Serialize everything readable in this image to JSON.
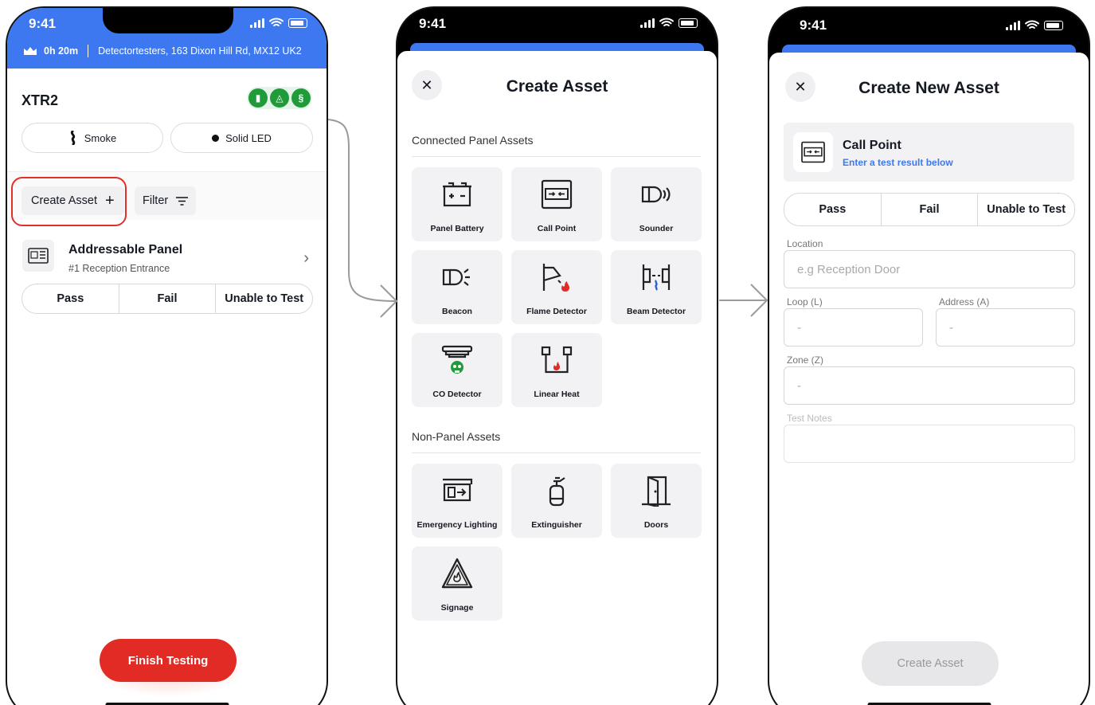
{
  "status_bar": {
    "time": "9:41"
  },
  "screen1": {
    "duration": "0h 20m",
    "site_address": "Detectortesters, 163 Dixon Hill Rd, MX12 UK2",
    "device_title": "XTR2",
    "pill_smoke": "Smoke",
    "pill_led": "Solid LED",
    "create_asset_label": "Create Asset",
    "filter_label": "Filter",
    "asset": {
      "name": "Addressable Panel",
      "subtitle": "#1 Reception Entrance"
    },
    "segment": [
      "Pass",
      "Fail",
      "Unable to Test"
    ],
    "finish_label": "Finish Testing"
  },
  "screen2": {
    "title": "Create Asset",
    "section_connected": "Connected Panel Assets",
    "connected_assets": [
      {
        "label": "Panel Battery",
        "icon": "panel-battery-icon"
      },
      {
        "label": "Call Point",
        "icon": "call-point-icon"
      },
      {
        "label": "Sounder",
        "icon": "sounder-icon"
      },
      {
        "label": "Beacon",
        "icon": "beacon-icon"
      },
      {
        "label": "Flame Detector",
        "icon": "flame-detector-icon"
      },
      {
        "label": "Beam Detector",
        "icon": "beam-detector-icon"
      },
      {
        "label": "CO Detector",
        "icon": "co-detector-icon"
      },
      {
        "label": "Linear Heat",
        "icon": "linear-heat-icon"
      }
    ],
    "section_non_panel": "Non-Panel Assets",
    "non_panel_assets": [
      {
        "label": "Emergency Lighting",
        "icon": "emergency-lighting-icon"
      },
      {
        "label": "Extinguisher",
        "icon": "extinguisher-icon"
      },
      {
        "label": "Doors",
        "icon": "door-icon"
      },
      {
        "label": "Signage",
        "icon": "signage-icon"
      }
    ]
  },
  "screen3": {
    "title": "Create New Asset",
    "asset_type": "Call Point",
    "asset_hint": "Enter a test result below",
    "segment": [
      "Pass",
      "Fail",
      "Unable to Test"
    ],
    "location_label": "Location",
    "location_placeholder": "e.g Reception Door",
    "loop_label": "Loop (L)",
    "loop_value": "-",
    "address_label": "Address (A)",
    "address_value": "-",
    "zone_label": "Zone (Z)",
    "zone_value": "-",
    "notes_label": "Test Notes",
    "create_label": "Create Asset"
  },
  "colors": {
    "accent": "#3d78f0",
    "danger": "#e12b24",
    "success": "#1f9b3a"
  }
}
